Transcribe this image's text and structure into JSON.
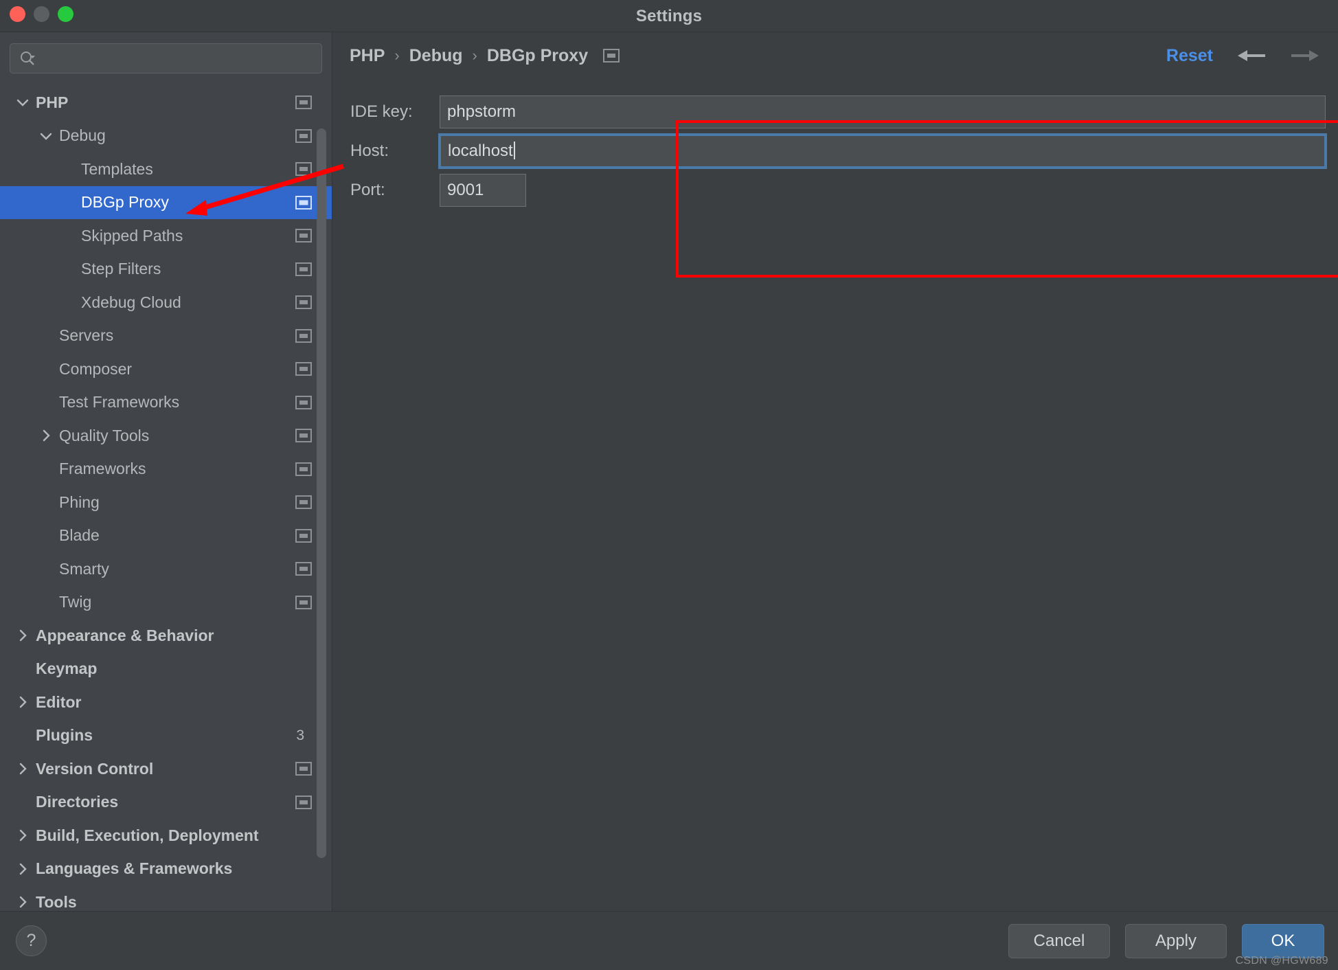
{
  "window": {
    "title": "Settings",
    "controls": {
      "close": "close",
      "minimize": "minimize",
      "maximize": "maximize"
    }
  },
  "sidebar": {
    "search": {
      "value": "",
      "placeholder": ""
    },
    "items": [
      {
        "label": "PHP",
        "level": 0,
        "chevron": "down",
        "bold": true,
        "marker": true,
        "selected": false
      },
      {
        "label": "Debug",
        "level": 1,
        "chevron": "down",
        "bold": false,
        "marker": true,
        "selected": false
      },
      {
        "label": "Templates",
        "level": 2,
        "chevron": "none",
        "bold": false,
        "marker": true,
        "selected": false
      },
      {
        "label": "DBGp Proxy",
        "level": 2,
        "chevron": "none",
        "bold": false,
        "marker": true,
        "selected": true
      },
      {
        "label": "Skipped Paths",
        "level": 2,
        "chevron": "none",
        "bold": false,
        "marker": true,
        "selected": false
      },
      {
        "label": "Step Filters",
        "level": 2,
        "chevron": "none",
        "bold": false,
        "marker": true,
        "selected": false
      },
      {
        "label": "Xdebug Cloud",
        "level": 2,
        "chevron": "none",
        "bold": false,
        "marker": true,
        "selected": false
      },
      {
        "label": "Servers",
        "level": 1,
        "chevron": "none",
        "bold": false,
        "marker": true,
        "selected": false
      },
      {
        "label": "Composer",
        "level": 1,
        "chevron": "none",
        "bold": false,
        "marker": true,
        "selected": false
      },
      {
        "label": "Test Frameworks",
        "level": 1,
        "chevron": "none",
        "bold": false,
        "marker": true,
        "selected": false
      },
      {
        "label": "Quality Tools",
        "level": 1,
        "chevron": "right",
        "bold": false,
        "marker": true,
        "selected": false
      },
      {
        "label": "Frameworks",
        "level": 1,
        "chevron": "none",
        "bold": false,
        "marker": true,
        "selected": false
      },
      {
        "label": "Phing",
        "level": 1,
        "chevron": "none",
        "bold": false,
        "marker": true,
        "selected": false
      },
      {
        "label": "Blade",
        "level": 1,
        "chevron": "none",
        "bold": false,
        "marker": true,
        "selected": false
      },
      {
        "label": "Smarty",
        "level": 1,
        "chevron": "none",
        "bold": false,
        "marker": true,
        "selected": false
      },
      {
        "label": "Twig",
        "level": 1,
        "chevron": "none",
        "bold": false,
        "marker": true,
        "selected": false
      },
      {
        "label": "Appearance & Behavior",
        "level": 0,
        "chevron": "right",
        "bold": true,
        "marker": false,
        "selected": false
      },
      {
        "label": "Keymap",
        "level": 0,
        "chevron": "none",
        "bold": true,
        "marker": false,
        "selected": false
      },
      {
        "label": "Editor",
        "level": 0,
        "chevron": "right",
        "bold": true,
        "marker": false,
        "selected": false
      },
      {
        "label": "Plugins",
        "level": 0,
        "chevron": "none",
        "bold": true,
        "marker": false,
        "selected": false,
        "badge": "3"
      },
      {
        "label": "Version Control",
        "level": 0,
        "chevron": "right",
        "bold": true,
        "marker": true,
        "selected": false
      },
      {
        "label": "Directories",
        "level": 0,
        "chevron": "none",
        "bold": true,
        "marker": true,
        "selected": false
      },
      {
        "label": "Build, Execution, Deployment",
        "level": 0,
        "chevron": "right",
        "bold": true,
        "marker": false,
        "selected": false
      },
      {
        "label": "Languages & Frameworks",
        "level": 0,
        "chevron": "right",
        "bold": true,
        "marker": false,
        "selected": false
      },
      {
        "label": "Tools",
        "level": 0,
        "chevron": "right",
        "bold": true,
        "marker": false,
        "selected": false
      }
    ]
  },
  "main": {
    "breadcrumb": {
      "items": [
        "PHP",
        "Debug",
        "DBGp Proxy"
      ],
      "separator": "›",
      "marker": true
    },
    "reset_label": "Reset",
    "nav": {
      "back": "back-arrow",
      "forward": "forward-arrow"
    },
    "form": {
      "fields": [
        {
          "label": "IDE key:",
          "value": "phpstorm",
          "focused": false,
          "size": "wide"
        },
        {
          "label": "Host:",
          "value": "localhost",
          "focused": true,
          "size": "wide"
        },
        {
          "label": "Port:",
          "value": "9001",
          "focused": false,
          "size": "narrow"
        }
      ]
    }
  },
  "footer": {
    "help_label": "?",
    "cancel_label": "Cancel",
    "apply_label": "Apply",
    "ok_label": "OK",
    "watermark": "CSDN @HGW689"
  },
  "colors": {
    "accent_blue": "#3267cc",
    "link_blue": "#4a90e8",
    "primary_button": "#3d6e9e",
    "annotation_red": "#ff0000",
    "window_bg": "#3c3f41",
    "sidebar_bg": "#414549"
  }
}
